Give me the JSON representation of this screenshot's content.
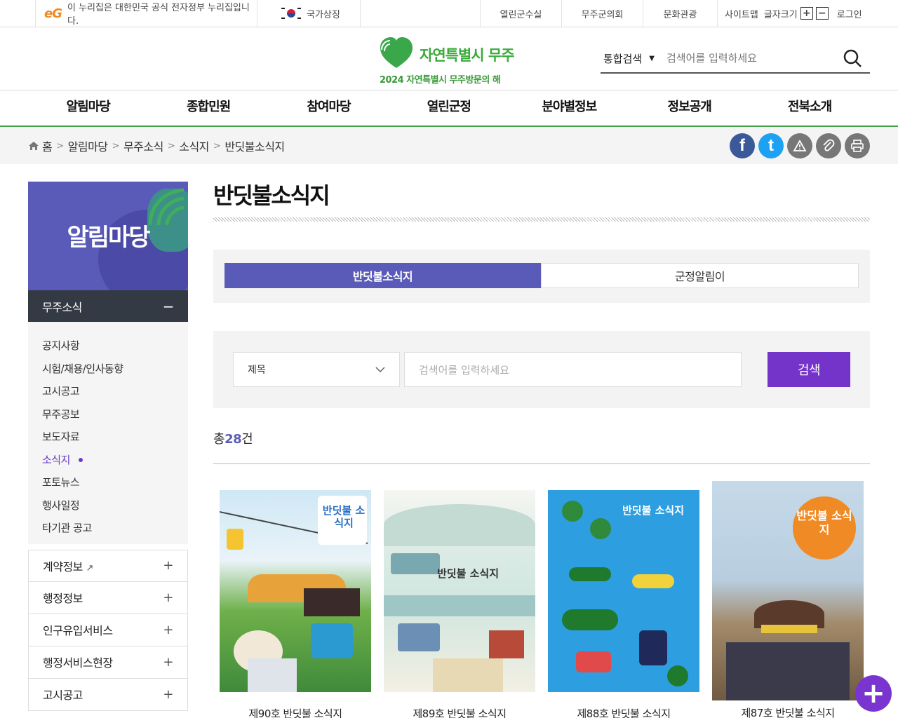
{
  "topbar": {
    "gov_notice": "이 누리집은 대한민국 공식 전자정부 누리집입니다.",
    "national_symbol": "국가상징",
    "links": [
      "열린군수실",
      "무주군의회",
      "문화관광"
    ],
    "sitemap": "사이트맵",
    "font_size_label": "글자크기",
    "font_plus": "+",
    "font_minus": "−",
    "login": "로그인"
  },
  "header": {
    "logo_name": "자연특별시 무주",
    "logo_slogan": "2024 자연특별시 무주방문의 해",
    "search_scope": "통합검색",
    "search_placeholder": "검색어를 입력하세요"
  },
  "gnb": [
    "알림마당",
    "종합민원",
    "참여마당",
    "열린군정",
    "분야별정보",
    "정보공개",
    "전북소개"
  ],
  "breadcrumb": [
    "홈",
    "알림마당",
    "무주소식",
    "소식지",
    "반딧불소식지"
  ],
  "share_icons": [
    {
      "name": "facebook-icon",
      "glyph": "f",
      "color": "#3b5998"
    },
    {
      "name": "twitter-icon",
      "glyph": "t",
      "color": "#1da1f2"
    },
    {
      "name": "report-icon",
      "glyph": "⚠",
      "color": "#777777"
    },
    {
      "name": "link-icon",
      "glyph": "🔗",
      "color": "#777777"
    },
    {
      "name": "print-icon",
      "glyph": "⎙",
      "color": "#777777"
    }
  ],
  "sidebar": {
    "title": "알림마당",
    "section": "무주소식",
    "section_toggle": "−",
    "items": [
      "공지사항",
      "시험/채용/인사동향",
      "고시공고",
      "무주공보",
      "보도자료",
      "소식지",
      "포토뉴스",
      "행사일정",
      "타기관 공고"
    ],
    "active_index": 5,
    "groups": [
      "계약정보",
      "행정정보",
      "인구유입서비스",
      "행정서비스현장",
      "고시공고"
    ],
    "external_mark": "↗",
    "group_toggle": "+"
  },
  "content": {
    "page_title": "반딧불소식지",
    "tabs": [
      "반딧불소식지",
      "군정알림이"
    ],
    "active_tab": 0,
    "search_field": "제목",
    "search_placeholder": "검색어를 입력하세요",
    "search_button": "검색",
    "total_prefix": "총",
    "total_count": "28",
    "total_suffix": "건"
  },
  "gallery": [
    {
      "title": "제90호 반딧불 소식지",
      "cover_text": "반딧불 소식지"
    },
    {
      "title": "제89호 반딧불 소식지",
      "cover_text": "반딧불 소식지"
    },
    {
      "title": "제88호 반딧불 소식지",
      "cover_text": "반딧불 소식지"
    },
    {
      "title": "제87호 반딧불 소식지",
      "cover_text": "반딧불 소식지"
    }
  ],
  "fab_label": "+"
}
